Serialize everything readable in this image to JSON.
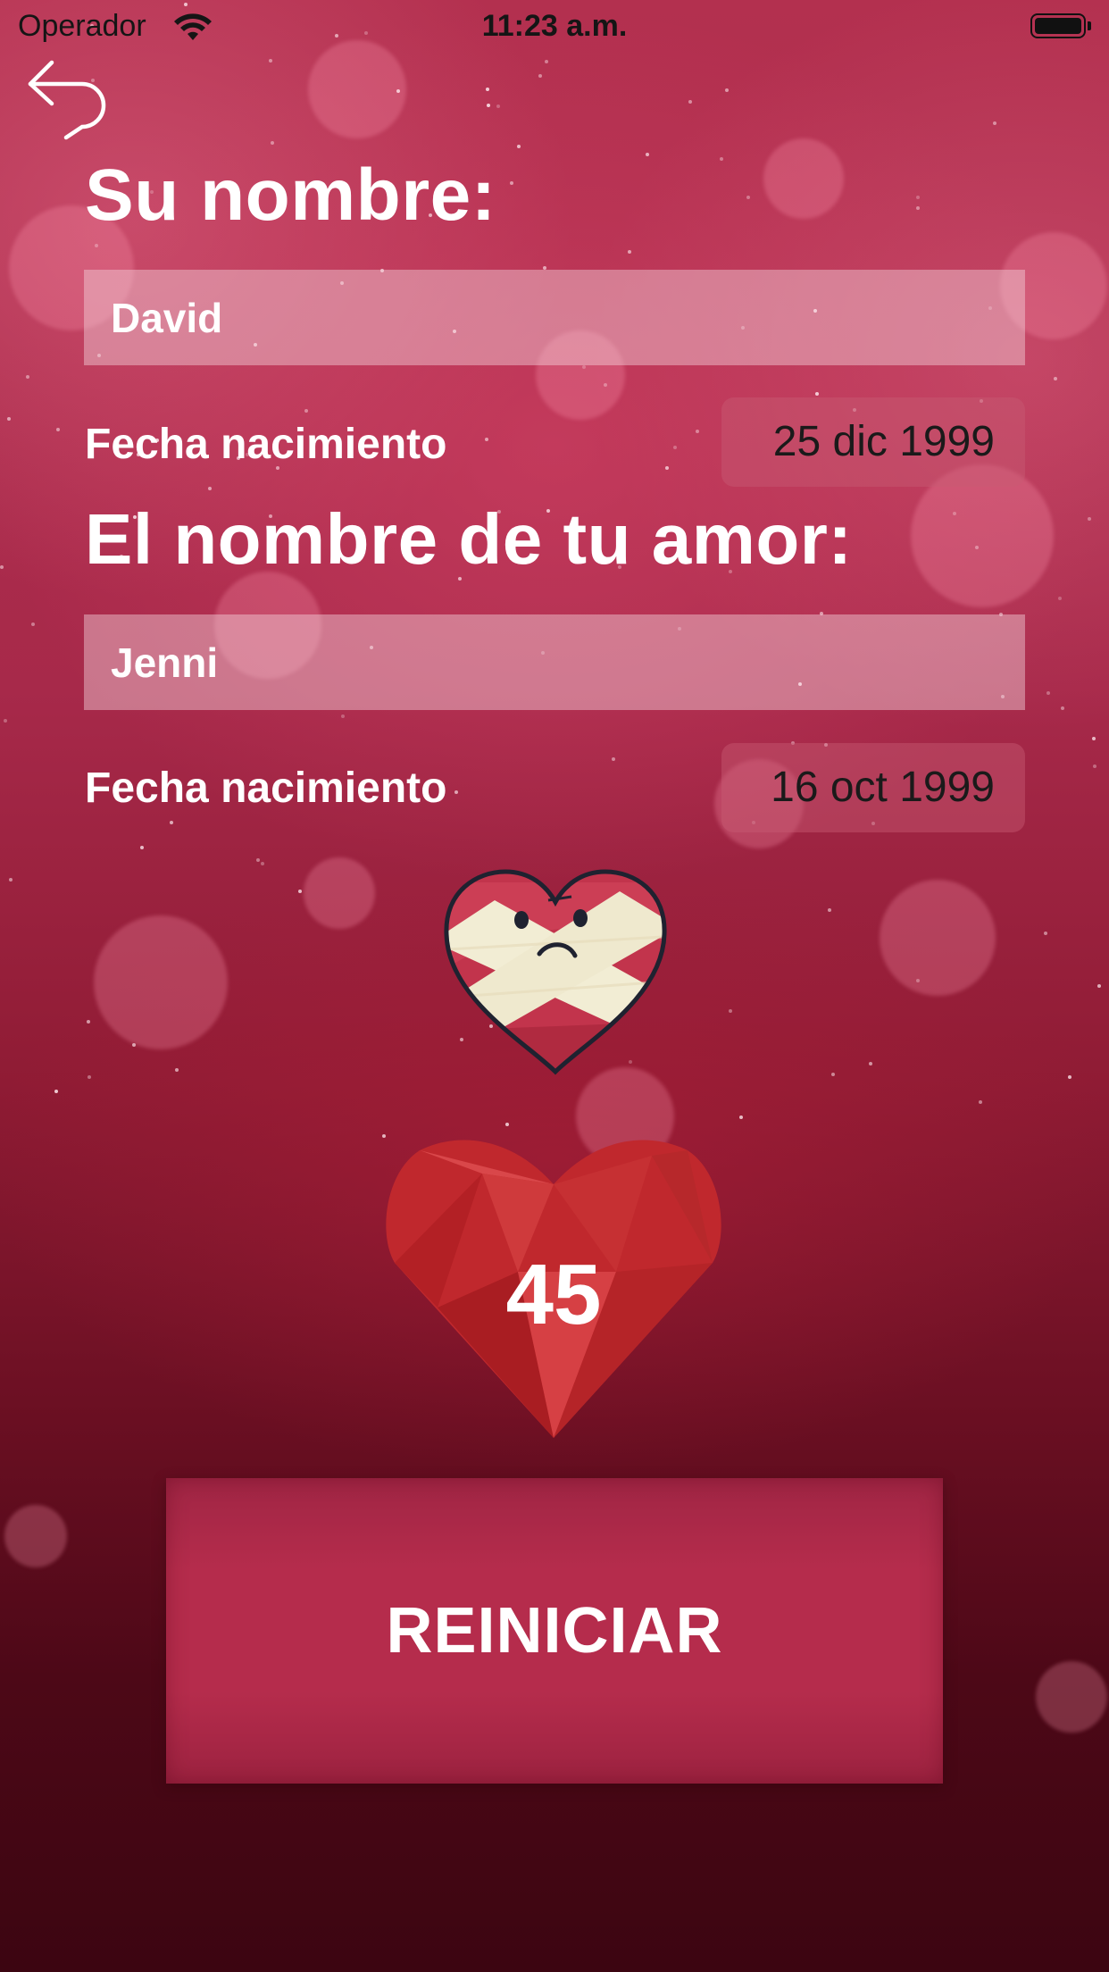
{
  "status_bar": {
    "carrier": "Operador",
    "time": "11:23 a.m.",
    "wifi_icon": "wifi-icon",
    "battery_icon": "battery-icon"
  },
  "navigation": {
    "back_icon": "back-arrow-icon"
  },
  "user": {
    "heading": "Su nombre:",
    "name_value": "David",
    "birth_label": "Fecha nacimiento",
    "birth_date": "25 dic 1999"
  },
  "partner": {
    "heading": "El nombre de tu amor:",
    "name_value": "Jenni",
    "birth_label": "Fecha nacimiento",
    "birth_date": "16 oct 1999"
  },
  "result": {
    "mood_icon": "bandaged-heart-icon",
    "score_icon": "heart-icon",
    "score": "45"
  },
  "actions": {
    "reset_label": "REINICIAR"
  },
  "colors": {
    "background": "#a7294a",
    "reset_button": "#b52c4c",
    "score_heart": "#c0282d"
  }
}
